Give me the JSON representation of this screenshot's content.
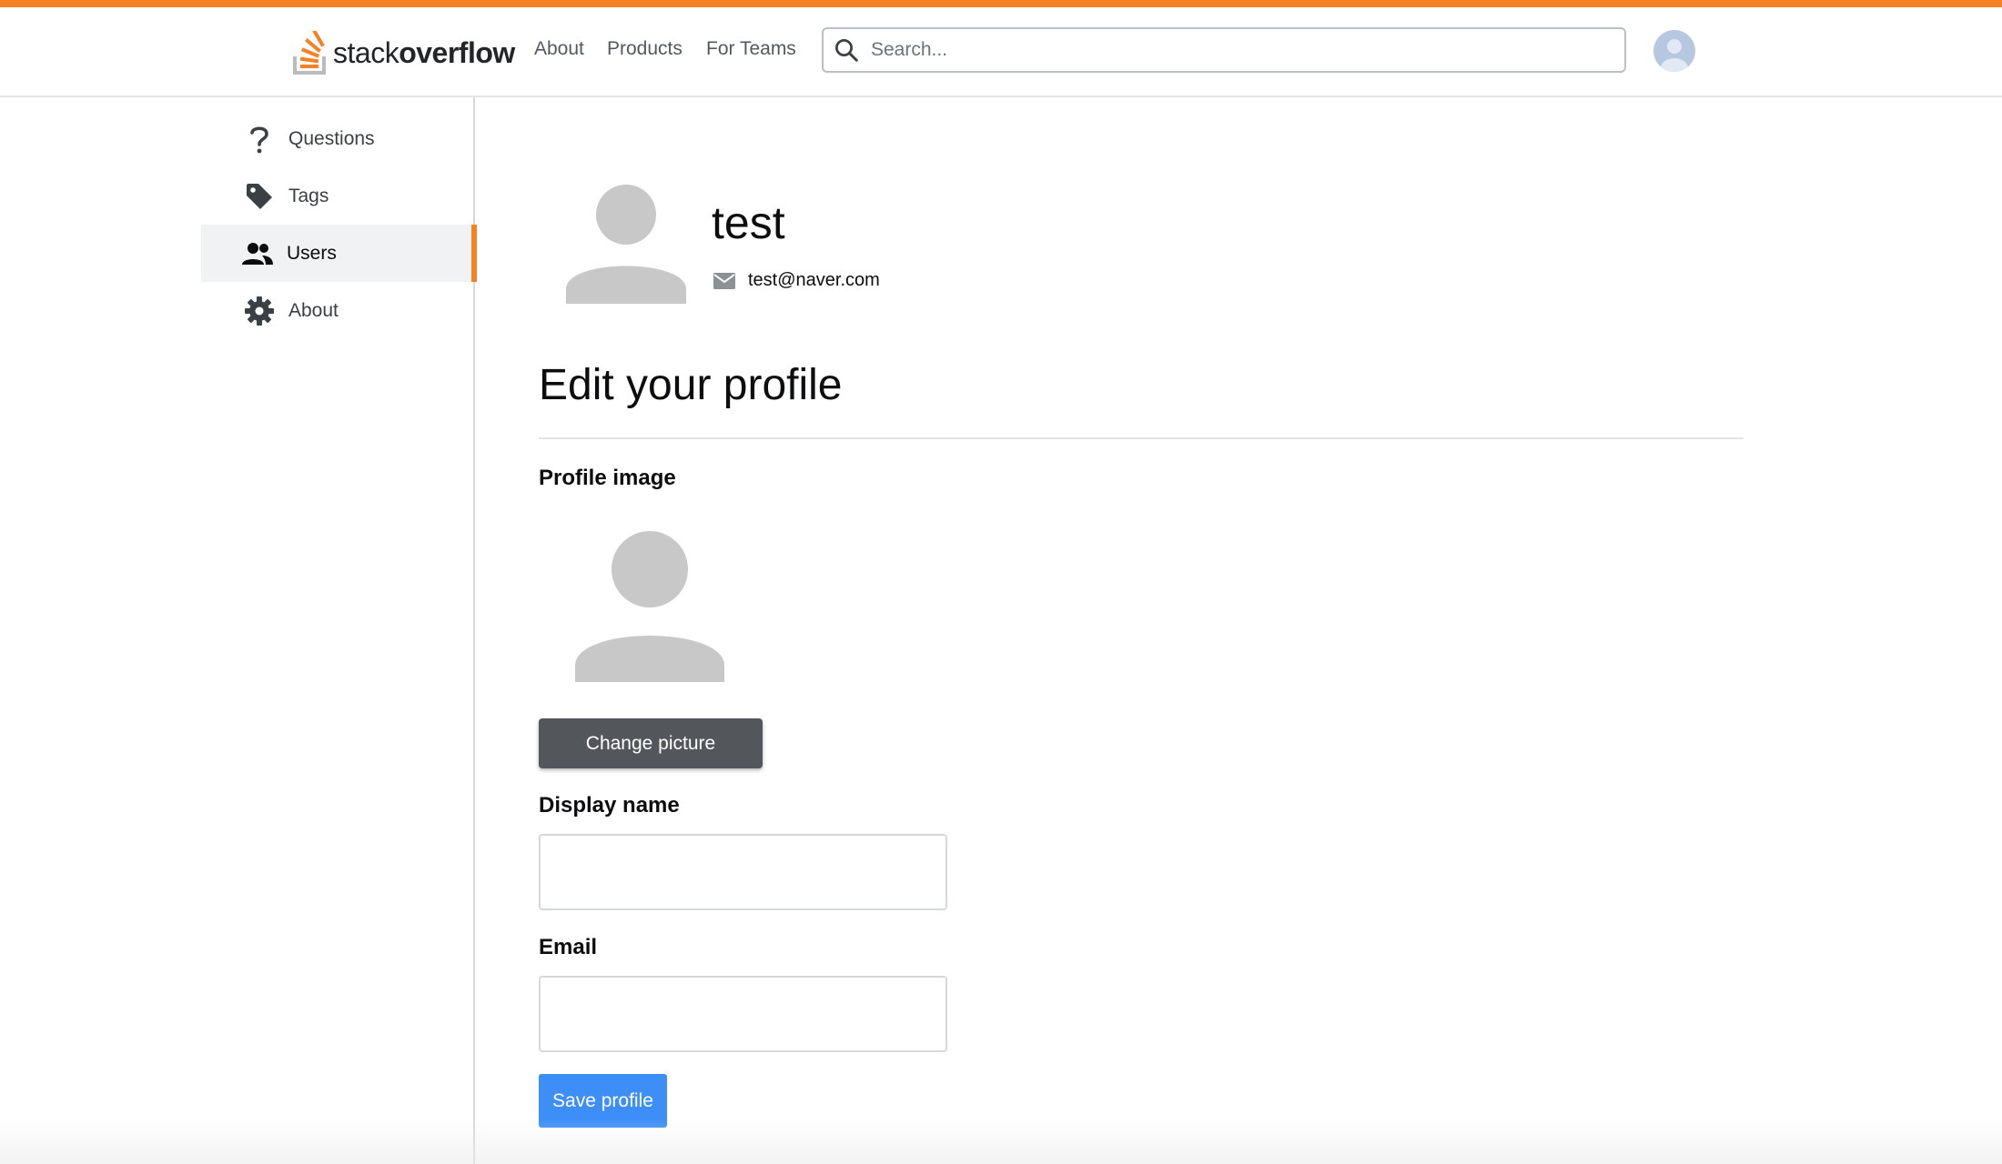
{
  "header": {
    "logo_light": "stack",
    "logo_bold": "overflow",
    "nav": [
      "About",
      "Products",
      "For Teams"
    ],
    "search_placeholder": "Search...",
    "accent_color": "#f48225"
  },
  "sidebar": {
    "items": [
      {
        "label": "Questions",
        "icon": "question-icon",
        "active": false
      },
      {
        "label": "Tags",
        "icon": "tag-icon",
        "active": false
      },
      {
        "label": "Users",
        "icon": "users-icon",
        "active": true
      },
      {
        "label": "About",
        "icon": "gear-icon",
        "active": false
      }
    ]
  },
  "profile": {
    "name": "test",
    "email": "test@naver.com"
  },
  "form": {
    "title": "Edit your profile",
    "profile_image_label": "Profile image",
    "change_picture": "Change picture",
    "display_name_label": "Display name",
    "display_name_value": "",
    "email_label": "Email",
    "email_value": "",
    "save": "Save profile",
    "save_color": "#3d8ef7"
  }
}
